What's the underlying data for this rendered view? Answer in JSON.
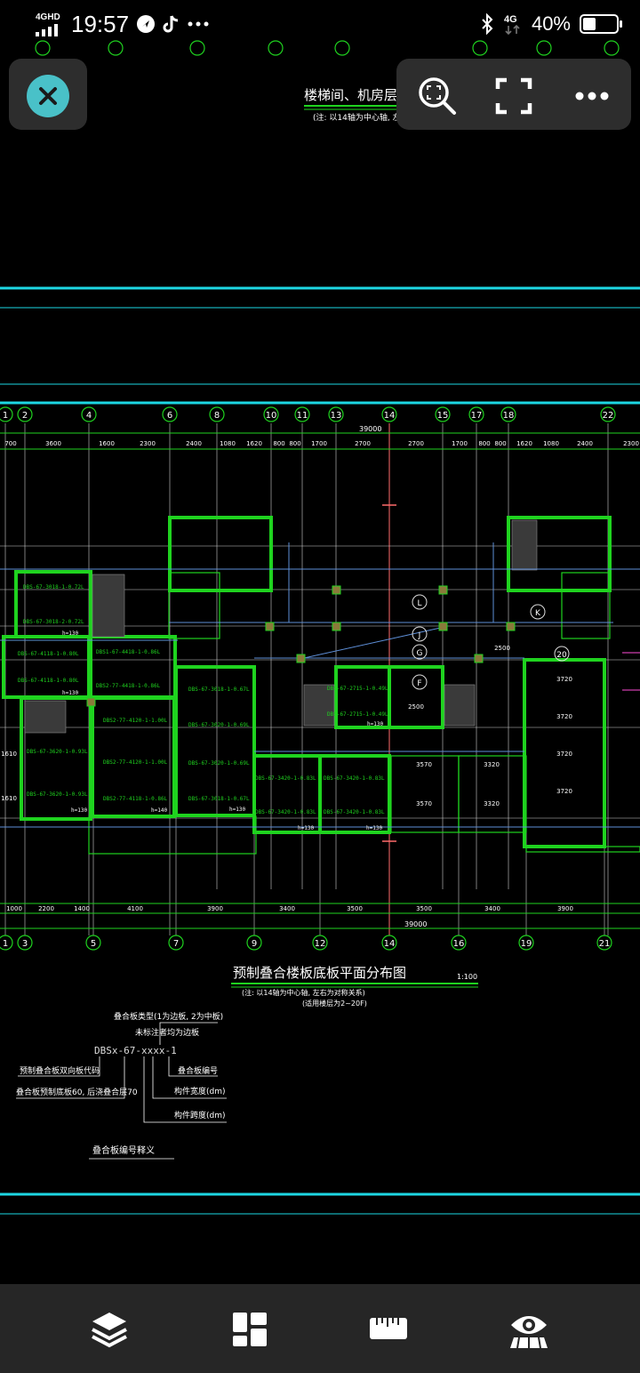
{
  "status_bar": {
    "network": "4GHD",
    "time": "19:57",
    "notif_icons": [
      "navigation-icon",
      "tiktok-icon",
      "more-dots-icon"
    ],
    "signal_label": "4G",
    "battery_percent": "40%",
    "battery_level": 0.4
  },
  "toolbar": {
    "icons": [
      "zoom-search-icon",
      "fullscreen-icon",
      "more-icon"
    ]
  },
  "drawing": {
    "top_title": "楼梯间、机房层屋",
    "top_note": "(注: 以14轴为中心轴, 左右",
    "total_dim_top": "39000",
    "total_dim_bottom": "39000",
    "top_axes": [
      "1",
      "2",
      "4",
      "6",
      "8",
      "10",
      "11",
      "13",
      "14",
      "15",
      "17",
      "18",
      "22"
    ],
    "bottom_axes": [
      "1",
      "3",
      "5",
      "7",
      "9",
      "12",
      "14",
      "16",
      "19",
      "21"
    ],
    "top_dims": [
      "700",
      "3600",
      "1600",
      "2300",
      "2400",
      "1080",
      "1620",
      "800",
      "800",
      "1700",
      "2700",
      "2700",
      "1700",
      "800",
      "800",
      "1620",
      "1080",
      "2400",
      "2300"
    ],
    "bottom_dims": [
      "1000",
      "2200",
      "1400",
      "4100",
      "3900",
      "3400",
      "3500",
      "3500",
      "3400",
      "3900"
    ],
    "grid_letters": [
      "L",
      "J",
      "G",
      "F",
      "K"
    ],
    "panel_labels": [
      "DBS-67-3018-1-0.72L",
      "DBS-67-3018-2-0.72L",
      "h=130",
      "DBS-67-4118-1-0.80L",
      "DBS-67-4118-1-0.80L",
      "h=130",
      "DBS1-67-4418-1-0.86L",
      "DBS2-77-4418-1-0.86L",
      "DBS-67-3018-1-0.67L",
      "DBS-67-3020-1-0.69L",
      "DBS-67-3020-1-0.69L",
      "DBS-67-3018-1-0.67L",
      "h=130",
      "DBS2-77-4120-1-1.00L",
      "DBS2-77-4120-1-1.00L",
      "DBS2-77-4118-1-0.86L",
      "h=140",
      "DBS-67-3620-1-0.93L",
      "DBS-67-3620-1-0.93L",
      "h=130",
      "DBS-67-2715-1-0.49L",
      "DBS-67-2715-1-0.49L",
      "h=130",
      "DBS-67-3420-1-0.83L",
      "DBS-67-3420-1-0.83L",
      "DBS-67-3420-1-0.83L",
      "DBS-67-3420-1-0.83L",
      "h=130",
      "h=130"
    ],
    "plan_dims": [
      "2500",
      "2500",
      "3570",
      "3320",
      "3570",
      "3320",
      "3720",
      "3720",
      "3720",
      "3720",
      "1610",
      "1610"
    ],
    "plan_title": "预制叠合楼板底板平面分布图",
    "plan_scale": "1:100",
    "plan_note1": "(注: 以14轴为中心轴, 左右为对称关系)",
    "plan_note2": "(适用楼层为2~20F)",
    "legend_code": "DBSx-67-xxxx-1",
    "legend_items": [
      "叠合板类型(1为边板, 2为中板)",
      "未标注者均为边板",
      "预制叠合板双向板代码",
      "叠合板预制底板60, 后浇叠合层70",
      "叠合板编号",
      "构件宽度(dm)",
      "构件跨度(dm)"
    ],
    "legend_title": "叠合板编号释义"
  },
  "bottom_bar": {
    "icons": [
      "layers-icon",
      "layout-icon",
      "ruler-icon",
      "view-icon"
    ]
  }
}
